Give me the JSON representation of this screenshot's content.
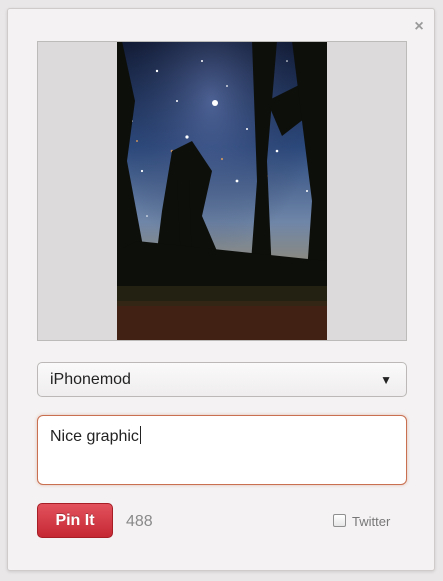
{
  "dialog": {
    "close_icon": "close-icon",
    "close_glyph": "×"
  },
  "preview": {
    "image_description_icon": "night-sky-forest-image"
  },
  "board_select": {
    "selected": "iPhonemod",
    "arrow_glyph": "▼"
  },
  "description": {
    "value": "Nice graphic"
  },
  "actions": {
    "pin_label": "Pin It",
    "char_count": "488",
    "twitter_label": "Twitter",
    "twitter_checked": false
  },
  "colors": {
    "pin_button": "#cf3039",
    "focus_border": "#c8704f"
  }
}
